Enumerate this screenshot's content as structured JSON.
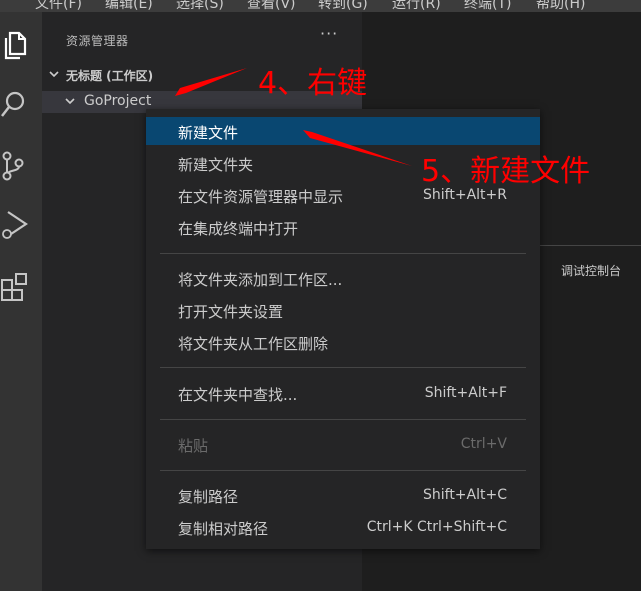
{
  "menubar": {
    "items": [
      "文件(F)",
      "编辑(E)",
      "选择(S)",
      "查看(V)",
      "转到(G)",
      "运行(R)",
      "终端(T)",
      "帮助(H)"
    ]
  },
  "activitybar": {
    "icons": [
      "files-icon",
      "search-icon",
      "source-control-icon",
      "run-debug-icon",
      "extensions-icon"
    ]
  },
  "sidebar": {
    "title": "资源管理器",
    "more": "···",
    "workspace": "无标题 (工作区)",
    "folder": "GoProject"
  },
  "panel": {
    "tab": "调试控制台"
  },
  "context_menu": {
    "items": [
      {
        "label": "新建文件",
        "shortcut": ""
      },
      {
        "label": "新建文件夹",
        "shortcut": ""
      },
      {
        "label": "在文件资源管理器中显示",
        "shortcut": "Shift+Alt+R"
      },
      {
        "label": "在集成终端中打开",
        "shortcut": ""
      },
      {
        "label": "将文件夹添加到工作区...",
        "shortcut": ""
      },
      {
        "label": "打开文件夹设置",
        "shortcut": ""
      },
      {
        "label": "将文件夹从工作区删除",
        "shortcut": ""
      },
      {
        "label": "在文件夹中查找...",
        "shortcut": "Shift+Alt+F"
      },
      {
        "label": "粘贴",
        "shortcut": "Ctrl+V"
      },
      {
        "label": "复制路径",
        "shortcut": "Shift+Alt+C"
      },
      {
        "label": "复制相对路径",
        "shortcut": "Ctrl+K Ctrl+Shift+C"
      }
    ]
  },
  "annotations": {
    "step4": "4、右键",
    "step5": "5、新建文件"
  },
  "colors": {
    "selection": "#094771",
    "annotation": "#ff0000",
    "activity_icon": "#c5c5c5"
  }
}
